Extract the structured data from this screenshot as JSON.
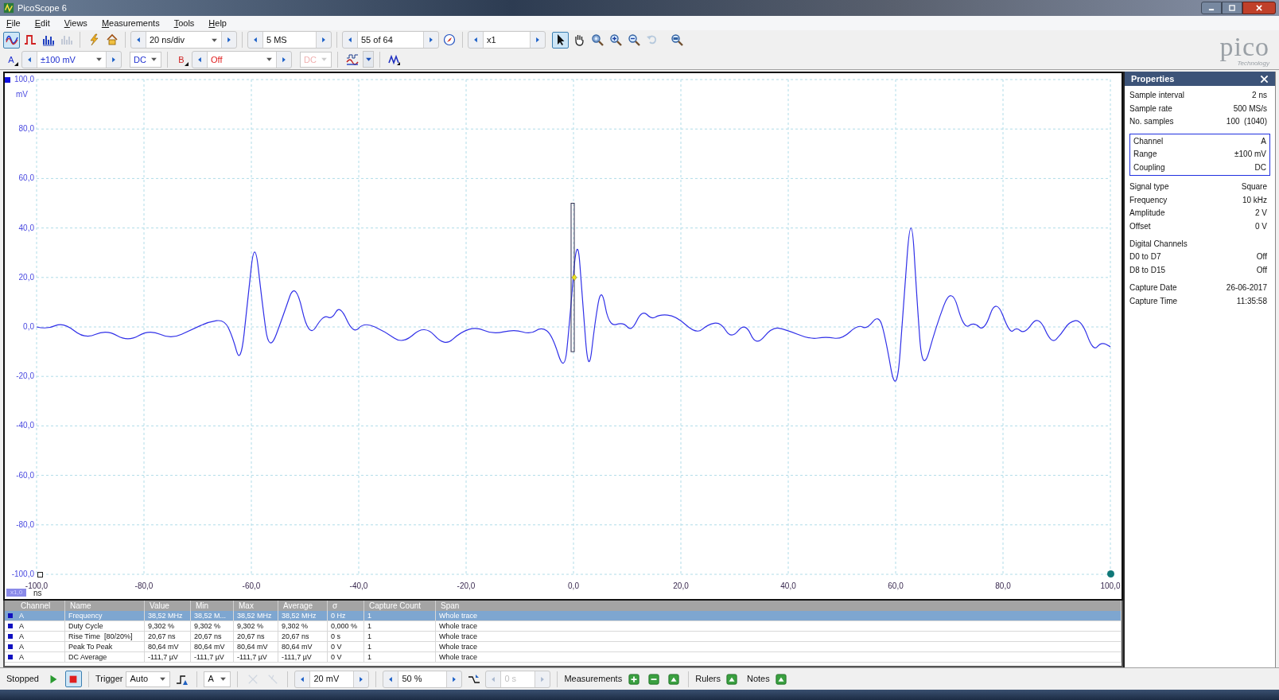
{
  "window": {
    "title": "PicoScope 6"
  },
  "menu": [
    "File",
    "Edit",
    "Views",
    "Measurements",
    "Tools",
    "Help"
  ],
  "toolbar": {
    "modes": [
      {
        "selected": true,
        "disabled": false
      },
      {
        "selected": false,
        "disabled": false
      },
      {
        "selected": false,
        "disabled": false
      },
      {
        "selected": false,
        "disabled": true
      }
    ],
    "timebase": "20 ns/div",
    "samples": "5 MS",
    "buffer": "55 of 64",
    "zoom": "x1",
    "tools": [
      {
        "selected": true,
        "disabled": false
      },
      {
        "selected": false,
        "disabled": false
      },
      {
        "selected": false,
        "disabled": false
      },
      {
        "selected": false,
        "disabled": false
      },
      {
        "selected": false,
        "disabled": false
      },
      {
        "selected": false,
        "disabled": true
      },
      {
        "selected": false,
        "disabled": false
      }
    ]
  },
  "channels": [
    {
      "label": "A",
      "range": "±100 mV",
      "coupling": "DC",
      "enabled": true
    },
    {
      "label": "B",
      "range": "Off",
      "coupling": "DC",
      "enabled": false
    }
  ],
  "logo": {
    "name": "pico",
    "tagline": "Technology"
  },
  "graph": {
    "y_labels": [
      "100,0",
      "80,0",
      "60,0",
      "40,0",
      "20,0",
      "0,0",
      "-20,0",
      "-40,0",
      "-60,0",
      "-80,0",
      "-100,0"
    ],
    "y_unit": "mV",
    "x_labels": [
      "-100,0",
      "-80,0",
      "-60,0",
      "-40,0",
      "-20,0",
      "0,0",
      "20,0",
      "40,0",
      "60,0",
      "80,0",
      "100,0"
    ],
    "x_unit": "ns",
    "zoom_badge": "x1,0"
  },
  "measurements": {
    "columns": [
      "Channel",
      "Name",
      "Value",
      "Min",
      "Max",
      "Average",
      "σ",
      "Capture Count",
      "Span"
    ],
    "rows": [
      {
        "selected": true,
        "cells": [
          "A",
          "Frequency",
          "38,52 MHz",
          "38,52 M...",
          "38,52 MHz",
          "38,52 MHz",
          "0 Hz",
          "1",
          "Whole trace"
        ]
      },
      {
        "selected": false,
        "cells": [
          "A",
          "Duty Cycle",
          "9,302 %",
          "9,302 %",
          "9,302 %",
          "9,302 %",
          "0,000 %",
          "1",
          "Whole trace"
        ]
      },
      {
        "selected": false,
        "cells": [
          "A",
          "Rise Time  [80/20%]",
          "20,67 ns",
          "20,67 ns",
          "20,67 ns",
          "20,67 ns",
          "0 s",
          "1",
          "Whole trace"
        ]
      },
      {
        "selected": false,
        "cells": [
          "A",
          "Peak To Peak",
          "80,64 mV",
          "80,64 mV",
          "80,64 mV",
          "80,64 mV",
          "0 V",
          "1",
          "Whole trace"
        ]
      },
      {
        "selected": false,
        "cells": [
          "A",
          "DC Average",
          "-111,7 µV",
          "-111,7 µV",
          "-111,7 µV",
          "-111,7 µV",
          "0 V",
          "1",
          "Whole trace"
        ]
      }
    ]
  },
  "properties": {
    "title": "Properties",
    "groups": [
      {
        "framed": false,
        "rows": [
          {
            "label": "Sample interval",
            "value": "2 ns"
          },
          {
            "label": "Sample rate",
            "value": "500 MS/s"
          },
          {
            "label": "No. samples",
            "value": "100  (1040)"
          }
        ]
      },
      {
        "framed": true,
        "rows": [
          {
            "label": "Channel",
            "value": "A"
          },
          {
            "label": "Range",
            "value": "±100 mV"
          },
          {
            "label": "Coupling",
            "value": "DC"
          }
        ]
      },
      {
        "framed": false,
        "rows": [
          {
            "label": "Signal type",
            "value": "Square"
          },
          {
            "label": "Frequency",
            "value": "10 kHz"
          },
          {
            "label": "Amplitude",
            "value": "2 V"
          },
          {
            "label": "Offset",
            "value": "0 V"
          }
        ]
      },
      {
        "framed": false,
        "heading": "Digital Channels",
        "rows": [
          {
            "label": "D0 to D7",
            "value": "Off"
          },
          {
            "label": "D8 to D15",
            "value": "Off"
          }
        ]
      },
      {
        "framed": false,
        "rows": [
          {
            "label": "Capture Date",
            "value": "26-06-2017"
          },
          {
            "label": "Capture Time",
            "value": "11:35:58"
          }
        ]
      }
    ]
  },
  "status_bar": {
    "run_state": "Stopped",
    "running": false,
    "trigger_label": "Trigger",
    "trigger_mode": "Auto",
    "trigger_source": "A",
    "threshold": "20 mV",
    "pre_trigger": "50 %",
    "delay": "0 s",
    "measurements_label": "Measurements",
    "rulers_label": "Rulers",
    "notes_label": "Notes"
  }
}
